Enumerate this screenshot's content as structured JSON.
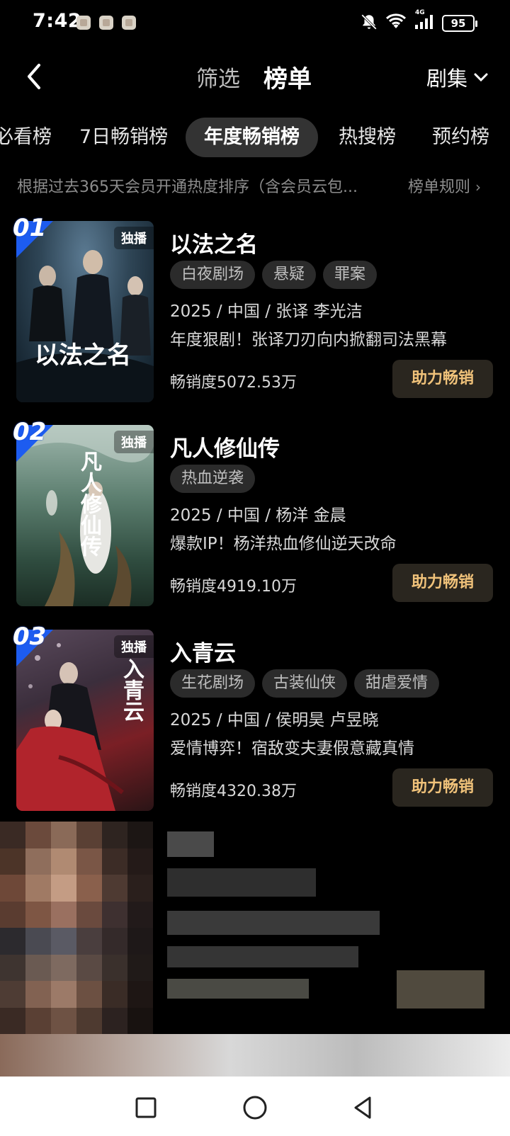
{
  "status": {
    "time": "7:42",
    "battery": "95",
    "network": "4G"
  },
  "header": {
    "filter": "筛选",
    "title": "榜单",
    "category": "剧集"
  },
  "tabs": [
    {
      "label": "必看榜"
    },
    {
      "label": "7日畅销榜"
    },
    {
      "label": "年度畅销榜"
    },
    {
      "label": "热搜榜"
    },
    {
      "label": "预约榜"
    }
  ],
  "description": "根据过去365天会员开通热度排序（含会员云包...",
  "rules_link": "榜单规则",
  "items": [
    {
      "rank": "01",
      "badge": "独播",
      "poster_title": "以法之名",
      "title": "以法之名",
      "tags": [
        "白夜剧场",
        "悬疑",
        "罪案"
      ],
      "meta": "2025 / 中国 / 张译 李光洁",
      "blurb": "年度狠剧！张译刀刃向内掀翻司法黑幕",
      "heat": "畅销度5072.53万",
      "button": "助力畅销"
    },
    {
      "rank": "02",
      "badge": "独播",
      "poster_title": "凡人修仙传",
      "title": "凡人修仙传",
      "tags": [
        "热血逆袭"
      ],
      "meta": "2025 / 中国 / 杨洋 金晨",
      "blurb": "爆款IP！杨洋热血修仙逆天改命",
      "heat": "畅销度4919.10万",
      "button": "助力畅销"
    },
    {
      "rank": "03",
      "badge": "独播",
      "poster_title": "入青云",
      "title": "入青云",
      "tags": [
        "生花剧场",
        "古装仙侠",
        "甜虐爱情"
      ],
      "meta": "2025 / 中国 / 侯明昊 卢昱晓",
      "blurb": "爱情博弈！宿敌变夫妻假意藏真情",
      "heat": "畅销度4320.38万",
      "button": "助力畅销"
    }
  ],
  "colors": {
    "background": "#000000",
    "rank_badge": "#1d5cf0",
    "boost_text": "#f0c27a",
    "tag_bg": "#2b2b2b"
  },
  "icons": {
    "back": "chevron-left-icon",
    "dropdown": "chevron-down-icon",
    "rules": "chevron-right-icon",
    "nav_recent": "square-icon",
    "nav_home": "circle-icon",
    "nav_back": "triangle-icon"
  }
}
